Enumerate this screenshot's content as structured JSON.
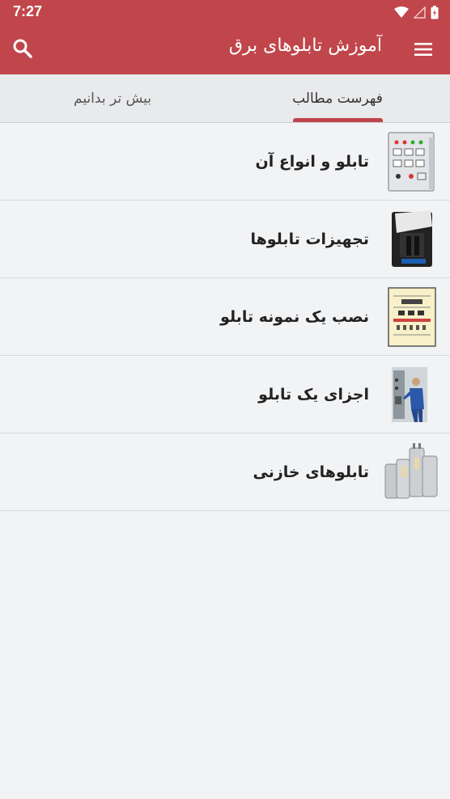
{
  "status_bar": {
    "time": "7:27",
    "icons": [
      "wifi-icon",
      "signal-icon",
      "battery-icon"
    ]
  },
  "app_bar": {
    "title": "آموزش تابلوهای برق",
    "menu_icon": "menu-icon",
    "search_icon": "search-icon"
  },
  "tabs": [
    {
      "label": "فهرست مطالب",
      "active": true
    },
    {
      "label": "بیش تر بدانیم",
      "active": false
    }
  ],
  "list": [
    {
      "label": "تابلو و انواع آن",
      "thumb": "control-panel-image"
    },
    {
      "label": "تجهیزات تابلوها",
      "thumb": "switch-device-image"
    },
    {
      "label": "نصب یک نمونه تابلو",
      "thumb": "panel-diagram-image"
    },
    {
      "label": "اجزای یک تابلو",
      "thumb": "technician-image"
    },
    {
      "label": "تابلوهای خازنی",
      "thumb": "capacitors-image"
    }
  ],
  "colors": {
    "primary": "#c0464b",
    "background": "#f2f3f5",
    "tab_bar": "#e9eaec"
  }
}
